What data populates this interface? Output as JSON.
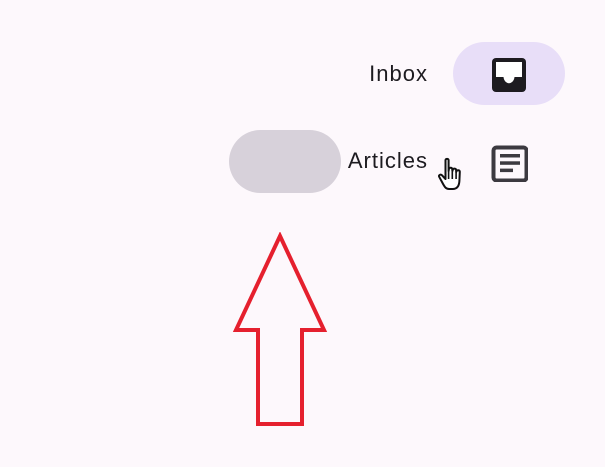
{
  "navigation": {
    "items": [
      {
        "label": "Inbox",
        "icon": "inbox-icon",
        "selected": true,
        "indicator_color": "#e8def8"
      },
      {
        "label": "Articles",
        "icon": "article-icon",
        "selected": false,
        "indicator_color": "#d7d1da"
      }
    ]
  },
  "colors": {
    "background": "#fdf8fc",
    "text": "#1d1b20",
    "icon": "#1d1b20",
    "annotation_arrow": "#e5202e"
  },
  "annotation": {
    "icon": "up-arrow-icon",
    "cursor": "hand-pointer-icon"
  }
}
